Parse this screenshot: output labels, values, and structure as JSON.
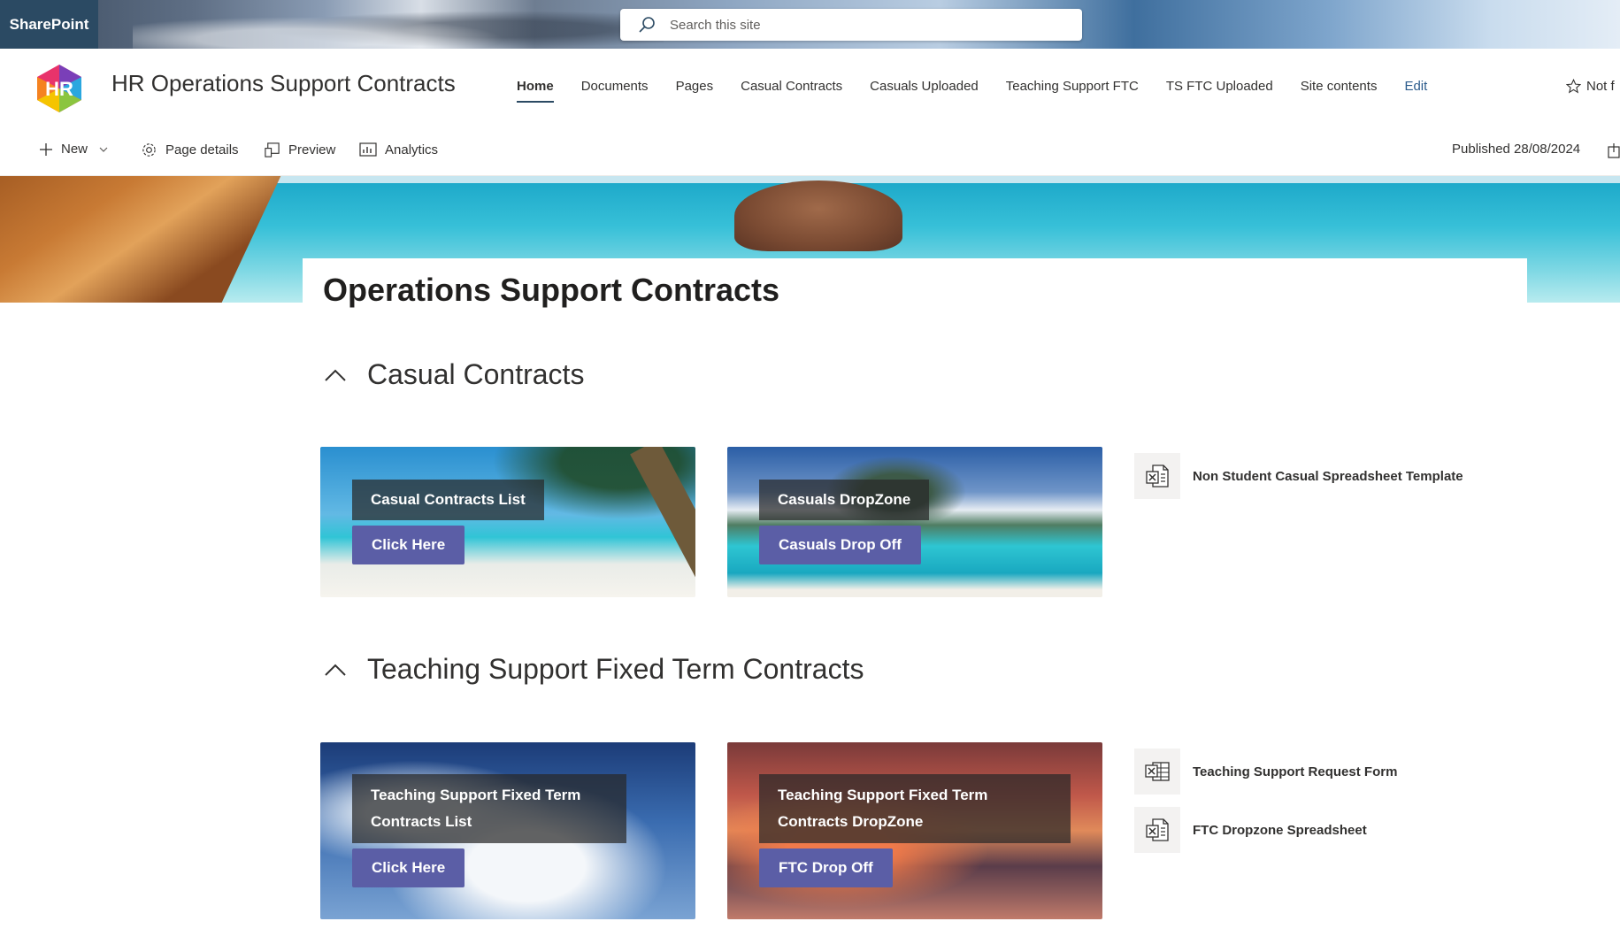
{
  "suite": {
    "brand": "SharePoint",
    "search_placeholder": "Search this site"
  },
  "site": {
    "logo_text": "HR",
    "title": "HR Operations Support Contracts"
  },
  "nav": {
    "items": [
      {
        "label": "Home",
        "active": true
      },
      {
        "label": "Documents"
      },
      {
        "label": "Pages"
      },
      {
        "label": "Casual Contracts"
      },
      {
        "label": "Casuals Uploaded"
      },
      {
        "label": "Teaching Support FTC"
      },
      {
        "label": "TS FTC Uploaded"
      },
      {
        "label": "Site contents"
      },
      {
        "label": "Edit"
      }
    ],
    "follow_label": "Not f"
  },
  "commands": {
    "new": "New",
    "page_details": "Page details",
    "preview": "Preview",
    "analytics": "Analytics",
    "published": "Published 28/08/2024"
  },
  "page": {
    "title": "Operations Support Contracts"
  },
  "sections": [
    {
      "heading": "Casual Contracts",
      "tiles": [
        {
          "label": "Casual Contracts List",
          "button": "Click Here"
        },
        {
          "label": "Casuals DropZone",
          "button": "Casuals Drop Off"
        }
      ],
      "files": [
        {
          "name": "Non Student Casual Spreadsheet Template",
          "icon": "excel-file-icon"
        }
      ]
    },
    {
      "heading": "Teaching Support Fixed Term Contracts",
      "tiles": [
        {
          "label_line1": "Teaching Support Fixed Term",
          "label_line2": "Contracts List",
          "button": "Click Here"
        },
        {
          "label_line1": "Teaching Support Fixed Term",
          "label_line2": "Contracts DropZone",
          "button": "FTC Drop Off"
        }
      ],
      "files": [
        {
          "name": "Teaching Support Request Form",
          "icon": "forms-icon"
        },
        {
          "name": "FTC Dropzone Spreadsheet",
          "icon": "excel-file-icon"
        }
      ]
    }
  ],
  "colors": {
    "accent_button": "#5b5ea6",
    "brand_bar": "#2b4a63"
  }
}
